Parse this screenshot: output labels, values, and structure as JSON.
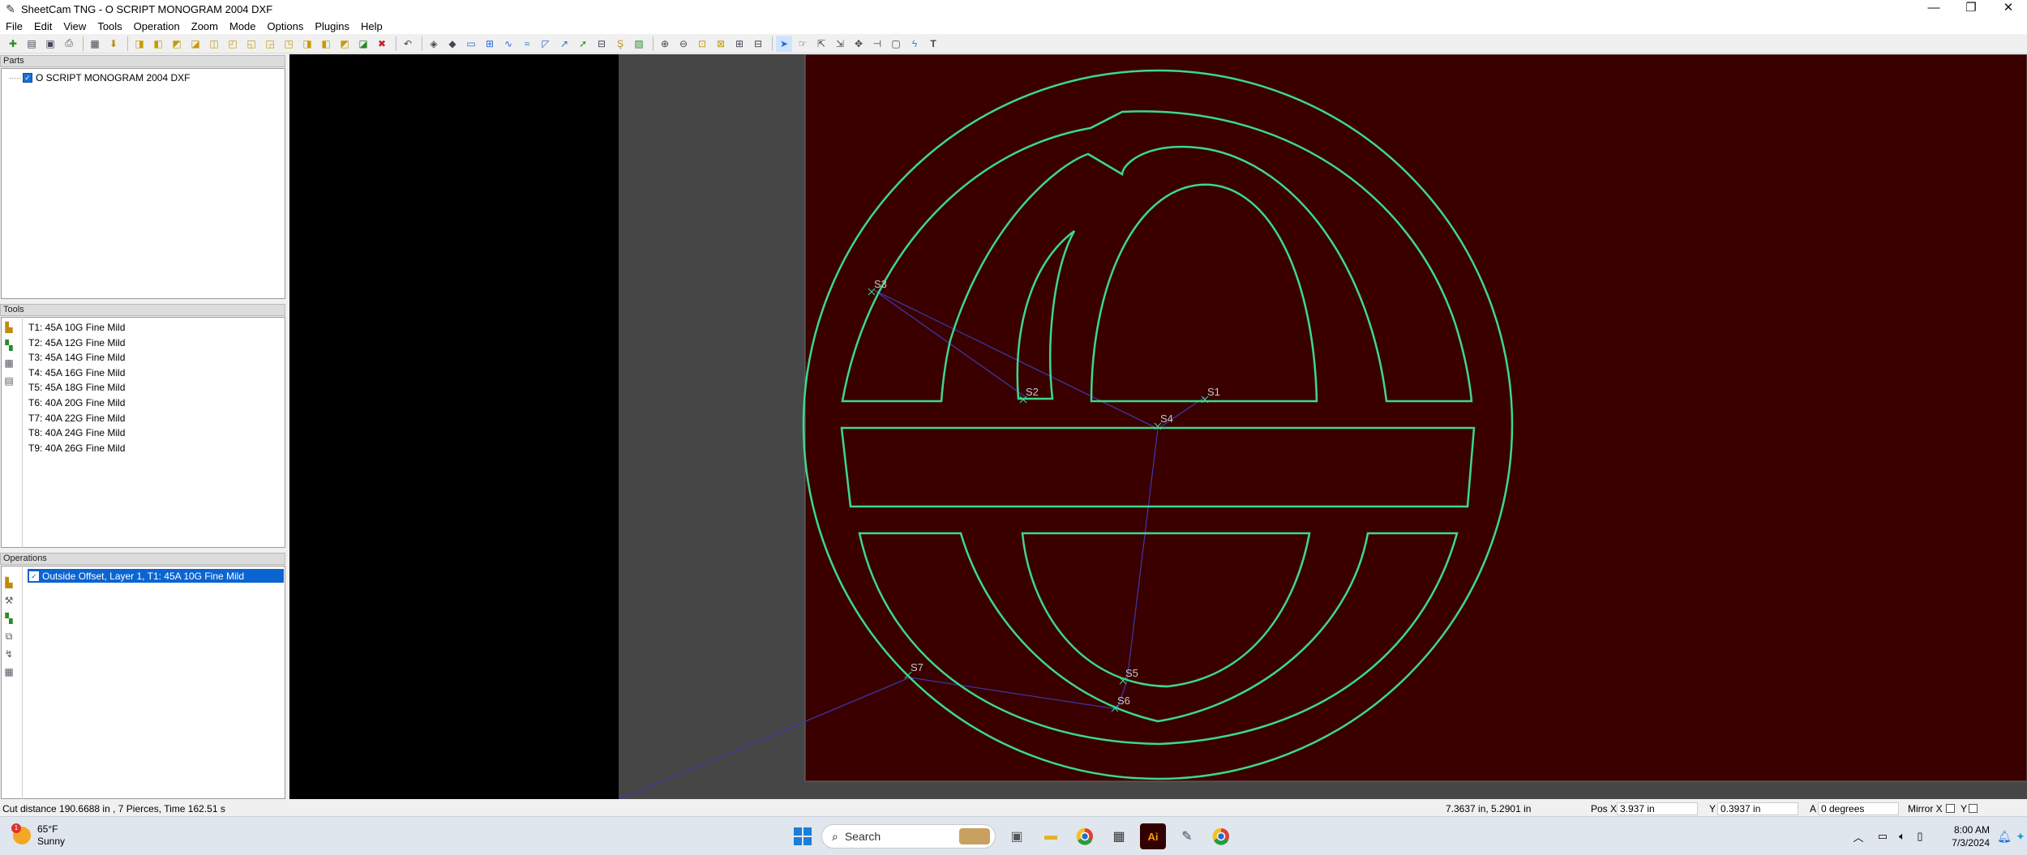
{
  "window": {
    "title": "SheetCam TNG - O SCRIPT MONOGRAM 2004 DXF"
  },
  "menu": [
    "File",
    "Edit",
    "View",
    "Tools",
    "Operation",
    "Zoom",
    "Mode",
    "Options",
    "Plugins",
    "Help"
  ],
  "panels": {
    "parts_title": "Parts",
    "part_name": "O SCRIPT MONOGRAM 2004 DXF",
    "tools_title": "Tools",
    "tools": [
      "T1: 45A 10G Fine Mild",
      "T2: 45A 12G Fine Mild",
      "T3: 45A 14G Fine Mild",
      "T4: 45A 16G Fine Mild",
      "T5: 45A 18G Fine Mild",
      "T6: 40A 20G Fine Mild",
      "T7: 40A 22G Fine Mild",
      "T8: 40A 24G Fine Mild",
      "T9: 40A 26G Fine Mild"
    ],
    "operations_title": "Operations",
    "operation": "Outside Offset, Layer 1, T1: 45A 10G Fine Mild"
  },
  "canvas": {
    "colors": {
      "sheet": "#3a0000",
      "path": "#3cd98a",
      "rapid": "#3a3ab0",
      "background": "#464646"
    },
    "start_labels": [
      "S1",
      "S2",
      "S3",
      "S4",
      "S5",
      "S6",
      "S7"
    ]
  },
  "status": {
    "cut_info": "Cut distance 190.6688 in , 7 Pierces, Time 162.51 s",
    "cursor": "7.3637 in, 5.2901 in",
    "pos_x_label": "Pos X",
    "pos_x": "3.937 in",
    "y_label": "Y",
    "y": "0.3937 in",
    "a_label": "A",
    "a": "0 degrees",
    "mirror_x": "Mirror X",
    "mirror_y": "Y"
  },
  "taskbar": {
    "temp": "65°F",
    "weather": "Sunny",
    "weather_alert": "1",
    "search": "Search",
    "time": "8:00 AM",
    "date": "7/3/2024"
  }
}
